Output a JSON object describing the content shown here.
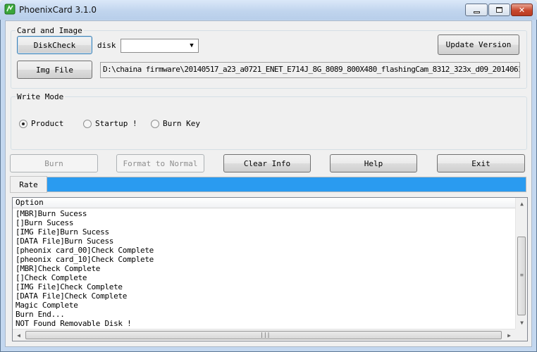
{
  "window": {
    "title": "PhoenixCard 3.1.0",
    "controls": {
      "minimize": "▭",
      "maximize": "▫",
      "close": "✕"
    }
  },
  "card_and_image": {
    "label": "Card and Image",
    "diskcheck_button": "DiskCheck",
    "disk_label": "disk",
    "disk_value": "",
    "update_button": "Update Version",
    "img_button": "Img File",
    "img_path": "D:\\chaina firmware\\20140517_a23_a0721_ENET_E714J_8G_8089_800X480_flashingCam_8312_323x_d09_2014061:"
  },
  "write_mode": {
    "label": "Write Mode",
    "options": [
      {
        "label": "Product",
        "checked": true
      },
      {
        "label": "Startup !",
        "checked": false
      },
      {
        "label": "Burn Key",
        "checked": false
      }
    ]
  },
  "actions": {
    "burn": "Burn",
    "format": "Format to Normal",
    "clear": "Clear Info",
    "help": "Help",
    "exit": "Exit"
  },
  "rate": {
    "label": "Rate",
    "progress": 1.0,
    "color": "#2a9bf0"
  },
  "log": {
    "header": "Option",
    "lines": [
      "[MBR]Burn Sucess",
      "[]Burn Sucess",
      "[IMG File]Burn Sucess",
      "[DATA File]Burn Sucess",
      "[pheonix card_00]Check Complete",
      "[pheonix card_10]Check Complete",
      "[MBR]Check Complete",
      "[]Check Complete",
      "[IMG File]Check Complete",
      "[DATA File]Check Complete",
      "Magic Complete",
      "Burn End...",
      "NOT Found Removable Disk !"
    ]
  }
}
